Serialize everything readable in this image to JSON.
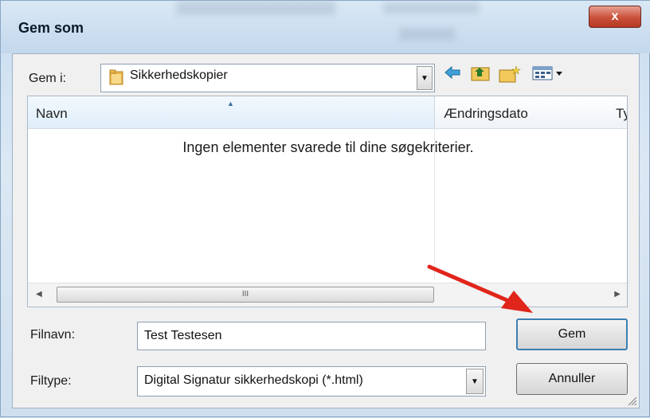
{
  "window": {
    "title": "Gem som",
    "close_label": "x"
  },
  "save_in": {
    "label": "Gem i:",
    "value": "Sikkerhedskopier",
    "dropdown_glyph": "▼"
  },
  "toolbar": {
    "icons": [
      "back-arrow-icon",
      "up-folder-icon",
      "new-folder-icon",
      "view-menu-icon"
    ]
  },
  "file_list": {
    "columns": [
      "Navn",
      "Ændringsdato",
      "Ty"
    ],
    "empty_message": "Ingen elementer svarede til dine søgekriterier.",
    "scroll_thumb_glyph": "III",
    "scroll_left_glyph": "◀",
    "scroll_right_glyph": "▶"
  },
  "filename": {
    "label": "Filnavn:",
    "value": "Test Testesen"
  },
  "filetype": {
    "label": "Filtype:",
    "value": "Digital Signatur sikkerhedskopi (*.html)",
    "dropdown_glyph": "▼"
  },
  "buttons": {
    "save_label": "Gem",
    "cancel_label": "Annuller"
  },
  "colors": {
    "annotation_arrow": "#e0251b",
    "accent": "#3c7fb1"
  }
}
